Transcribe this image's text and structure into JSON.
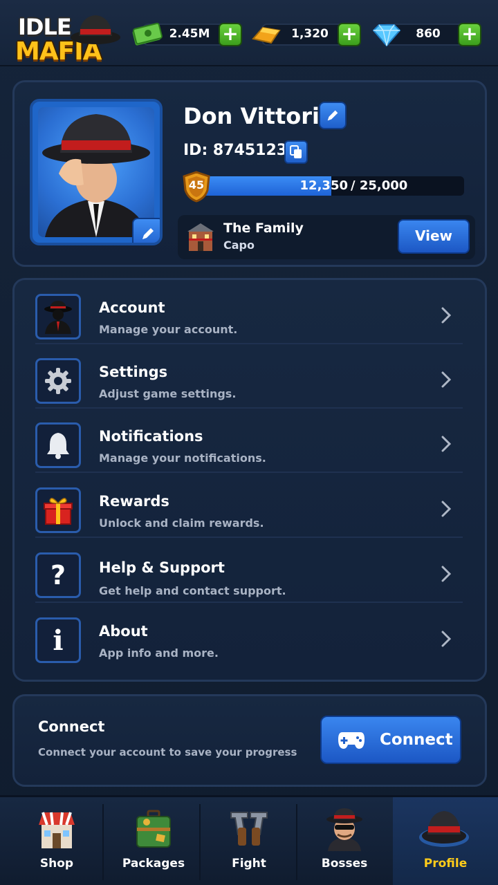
{
  "app": {
    "logo_line1": "IDLE",
    "logo_line2": "MAFIA"
  },
  "resources": [
    {
      "name": "cash",
      "icon": "cash-icon",
      "value": "2.45M"
    },
    {
      "name": "gold",
      "icon": "gold-bar-icon",
      "value": "1,320"
    },
    {
      "name": "gems",
      "icon": "diamond-icon",
      "value": "860"
    }
  ],
  "profile": {
    "name": "Don Vittorio",
    "id_label": "ID: 87451236",
    "level": "45",
    "xp_current": "12,350",
    "xp_total": "/ 25,000",
    "xp_fraction": 0.494,
    "family_name": "The Family",
    "family_role": "Capo",
    "view_label": "View"
  },
  "menu": [
    {
      "title": "Account",
      "subtitle": "Manage your account.",
      "icon": "mafioso-icon"
    },
    {
      "title": "Settings",
      "subtitle": "Adjust game settings.",
      "icon": "gear-icon"
    },
    {
      "title": "Notifications",
      "subtitle": "Manage your notifications.",
      "icon": "bell-icon"
    },
    {
      "title": "Rewards",
      "subtitle": "Unlock and claim rewards.",
      "icon": "gift-icon"
    },
    {
      "title": "Help & Support",
      "subtitle": "Get help and contact support.",
      "icon": "question-icon"
    },
    {
      "title": "About",
      "subtitle": "App info and more.",
      "icon": "info-icon"
    }
  ],
  "connect": {
    "title": "Connect",
    "subtitle": "Connect your account to save your progress",
    "button_label": "Connect"
  },
  "nav": [
    {
      "label": "Shop",
      "icon": "shop-icon"
    },
    {
      "label": "Packages",
      "icon": "suitcase-icon"
    },
    {
      "label": "Fight",
      "icon": "pistols-icon"
    },
    {
      "label": "Bosses",
      "icon": "boss-icon"
    },
    {
      "label": "Profile",
      "icon": "fedora-icon",
      "active": true
    }
  ],
  "colors": {
    "accent_blue": "#1f66c9",
    "active_nav": "#ffcc1a",
    "plus_green": "#4cb526"
  }
}
